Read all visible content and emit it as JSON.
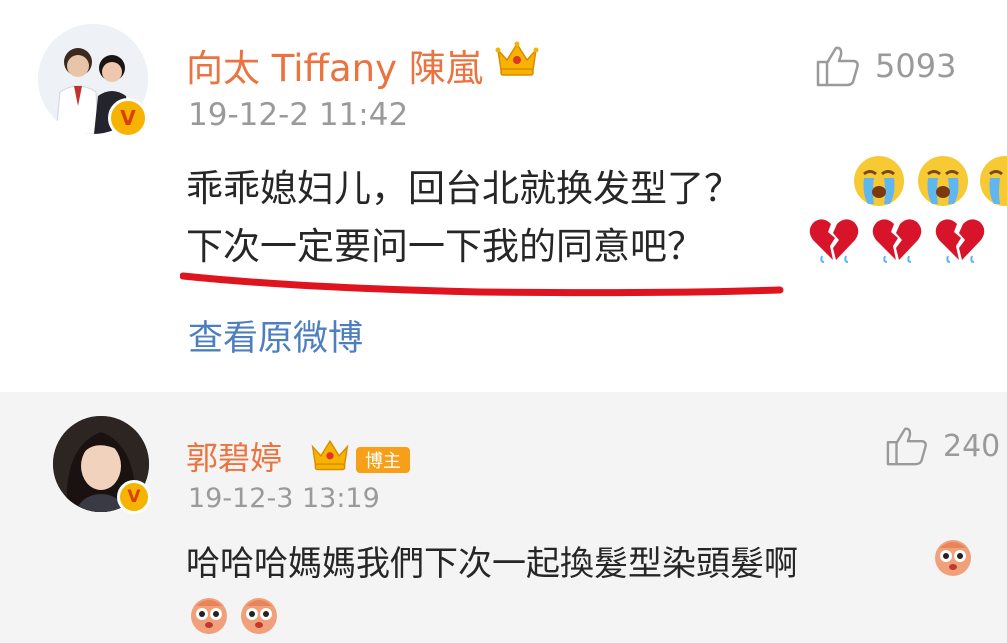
{
  "comments": [
    {
      "username": "向太 Tiffany 陳嵐",
      "timestamp": "19-12-2 11:42",
      "likes": "5093",
      "text_line_1": "乖乖媳妇儿，回台北就换发型了？",
      "text_line_2": "下次一定要问一下我的同意吧？",
      "emoji_line_1": [
        "crying-face",
        "crying-face",
        "crying-face"
      ],
      "emoji_line_2": [
        "broken-heart",
        "broken-heart",
        "broken-heart"
      ],
      "view_original": "查看原微博",
      "verified": true,
      "crown_badge": true
    },
    {
      "username": "郭碧婷",
      "host_badge": "博主",
      "timestamp": "19-12-3 13:19",
      "likes": "240",
      "text_line_1": "哈哈哈媽媽我們下次一起換髮型染頭髮啊",
      "emoji": [
        "cute-face",
        "cute-face",
        "cute-face"
      ],
      "verified": true,
      "crown_badge": true
    }
  ],
  "colors": {
    "username": "#eb7340",
    "meta": "#9a9a9a",
    "link": "#4d7fbf",
    "underline": "#e0141e",
    "verified_badge": "#f6b400",
    "host_badge": "#f6a01a"
  }
}
